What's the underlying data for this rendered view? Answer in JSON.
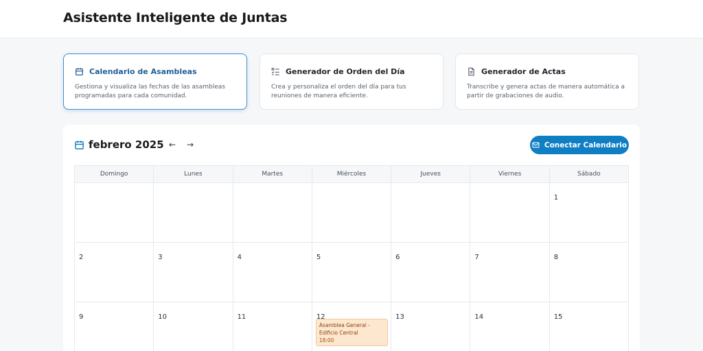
{
  "header": {
    "title": "Asistente Inteligente de Juntas"
  },
  "colors": {
    "accent": "#0f7ec2",
    "active_border": "#3f8fd0",
    "event_bg": "#fde8cf"
  },
  "feature_cards": [
    {
      "title": "Calendario de Asambleas",
      "description": "Gestiona y visualiza las fechas de las asambleas programadas para cada comunidad.",
      "icon": "calendar-icon",
      "active": true
    },
    {
      "title": "Generador de Orden del Día",
      "description": "Crea y personaliza el orden del día para tus reuniones de manera eficiente.",
      "icon": "checklist-icon",
      "active": false
    },
    {
      "title": "Generador de Actas",
      "description": "Transcribe y genera actas de manera automática a partir de grabaciones de audio.",
      "icon": "document-icon",
      "active": false
    }
  ],
  "calendar": {
    "month_label": "febrero 2025",
    "prev_label": "←",
    "next_label": "→",
    "connect_label": "Conectar Calendario",
    "weekdays": [
      "Domingo",
      "Lunes",
      "Martes",
      "Miércoles",
      "Jueves",
      "Viernes",
      "Sábado"
    ],
    "weeks": [
      [
        "",
        "",
        "",
        "",
        "",
        "",
        "1"
      ],
      [
        "2",
        "3",
        "4",
        "5",
        "6",
        "7",
        "8"
      ],
      [
        "9",
        "10",
        "11",
        "12",
        "13",
        "14",
        "15"
      ]
    ],
    "event": {
      "title": "Asamblea General - Edificio Central",
      "time": "18:00",
      "day": "12"
    }
  }
}
